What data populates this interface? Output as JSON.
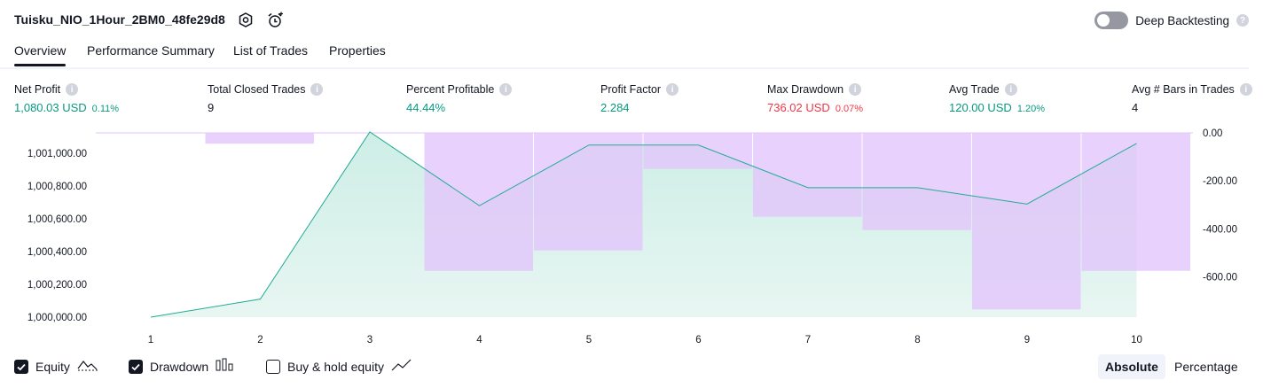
{
  "header": {
    "title": "Tuisku_NIO_1Hour_2BM0_48fe29d8",
    "deep_backtesting_label": "Deep Backtesting"
  },
  "tabs": [
    {
      "label": "Overview",
      "active": true
    },
    {
      "label": "Performance Summary",
      "active": false
    },
    {
      "label": "List of Trades",
      "active": false
    },
    {
      "label": "Properties",
      "active": false
    }
  ],
  "stats": [
    {
      "label": "Net Profit",
      "value": "1,080.03 USD",
      "pct": "0.11%",
      "tone": "pos"
    },
    {
      "label": "Total Closed Trades",
      "value": "9",
      "pct": "",
      "tone": "plain"
    },
    {
      "label": "Percent Profitable",
      "value": "44.44%",
      "pct": "",
      "tone": "pos"
    },
    {
      "label": "Profit Factor",
      "value": "2.284",
      "pct": "",
      "tone": "pos"
    },
    {
      "label": "Max Drawdown",
      "value": "736.02 USD",
      "pct": "0.07%",
      "tone": "neg"
    },
    {
      "label": "Avg Trade",
      "value": "120.00 USD",
      "pct": "1.20%",
      "tone": "pos"
    },
    {
      "label": "Avg # Bars in Trades",
      "value": "4",
      "pct": "",
      "tone": "plain"
    }
  ],
  "chart_data": {
    "type": "area",
    "x": [
      1,
      2,
      3,
      4,
      5,
      6,
      7,
      8,
      9,
      10
    ],
    "series": [
      {
        "name": "Equity",
        "axis": "left",
        "values": [
          1000000,
          1000110,
          1001130,
          1000680,
          1001050,
          1001050,
          1000790,
          1000790,
          1000690,
          1001060
        ]
      },
      {
        "name": "Drawdown",
        "axis": "right",
        "values": [
          0,
          -45,
          0,
          -575,
          -490,
          -150,
          -350,
          -405,
          -736,
          -575
        ]
      }
    ],
    "left_ticks": [
      "1,000,000.00",
      "1,000,200.00",
      "1,000,400.00",
      "1,000,600.00",
      "1,000,800.00",
      "1,001,000.00"
    ],
    "left_tick_values": [
      1000000,
      1000200,
      1000400,
      1000600,
      1000800,
      1001000
    ],
    "right_ticks": [
      "0.00",
      "-200.00",
      "-400.00",
      "-600.00"
    ],
    "right_tick_values": [
      0,
      -200,
      -400,
      -600
    ],
    "colors": {
      "equity_line": "#22ab94",
      "equity_fill": "#cdeee6",
      "drawdown_fill": "#e2c6fb",
      "overlap_fill": "#b3b6e8"
    }
  },
  "legend": {
    "equity": {
      "label": "Equity",
      "checked": true
    },
    "drawdown": {
      "label": "Drawdown",
      "checked": true
    },
    "buyhold": {
      "label": "Buy & hold equity",
      "checked": false
    }
  },
  "view_toggle": {
    "absolute": "Absolute",
    "percentage": "Percentage",
    "selected": "Absolute"
  }
}
